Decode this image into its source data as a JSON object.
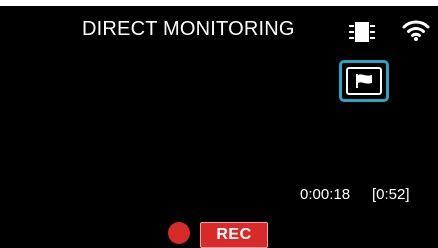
{
  "screen": {
    "title": "DIRECT MONITORING",
    "elapsed_time": "0:00:18",
    "remaining_time": "[0:52]",
    "rec_label": "REC"
  },
  "icons": {
    "card": "memory-card-icon",
    "wifi": "wifi-icon",
    "flag": "flag-icon",
    "rec_dot": "record-dot"
  },
  "colors": {
    "background": "#000000",
    "text": "#ffffff",
    "accent_border": "#27a3c4",
    "record_red": "#d92a2a"
  }
}
